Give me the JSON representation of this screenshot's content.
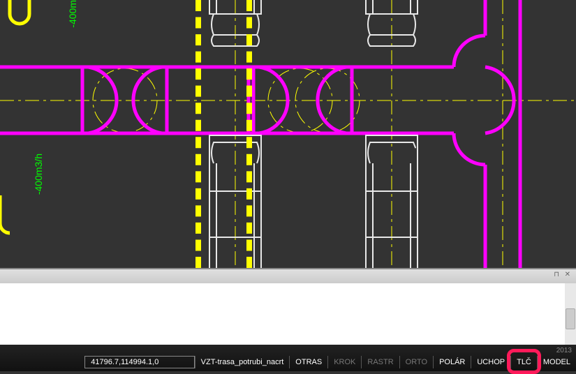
{
  "canvas": {
    "text_labels": {
      "upper": "-400m",
      "lower": "-400m3/h"
    }
  },
  "statusbar": {
    "coordinates": "41796.7,114994.1,0",
    "layout": "VZT-trasa_potrubi_nacrt",
    "buttons": {
      "otras": "OTRAS",
      "krok": "KROK",
      "rastr": "RASTR",
      "orto": "ORTO",
      "polar": "POLÁR",
      "uchop": "UCHOP",
      "tlc": "TLČ",
      "model": "MODEL"
    },
    "version": "2013"
  }
}
